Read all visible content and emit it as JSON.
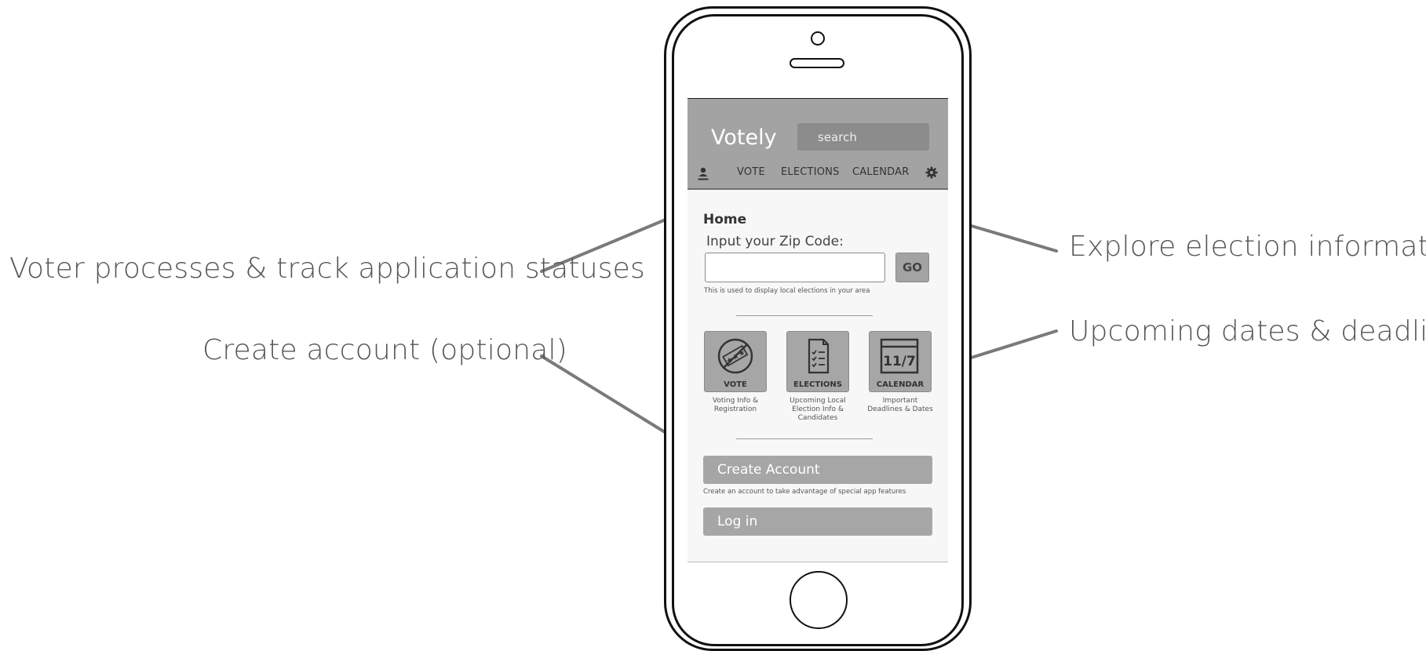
{
  "annotations": {
    "vote": "Voter processes & track application statuses",
    "account": "Create account (optional)",
    "elections": "Explore election information",
    "calendar": "Upcoming dates & deadlines"
  },
  "app": {
    "title": "Votely",
    "search_placeholder": "search",
    "nav": [
      "VOTE",
      "ELECTIONS",
      "CALENDAR"
    ],
    "home_title": "Home",
    "zip_label": "Input your Zip Code:",
    "zip_value": "",
    "go_label": "GO",
    "zip_hint": "This is used to display local elections in your area",
    "tiles": [
      {
        "label": "VOTE",
        "desc": "Voting Info & Registration",
        "icon": "ballot-icon"
      },
      {
        "label": "ELECTIONS",
        "desc": "Upcoming Local Election Info & Candidates",
        "icon": "checklist-icon"
      },
      {
        "label": "CALENDAR",
        "desc": "Important Deadlines & Dates",
        "icon": "calendar-icon",
        "icon_text": "11/7"
      }
    ],
    "create_account_label": "Create Account",
    "create_account_hint": "Create an account to take advantage of special app features",
    "login_label": "Log in"
  },
  "colors": {
    "header": "#a3a3a3",
    "search_bg": "#8c8c8c",
    "tile": "#a6a6a6",
    "annotation_line": "#7a7a7a"
  }
}
